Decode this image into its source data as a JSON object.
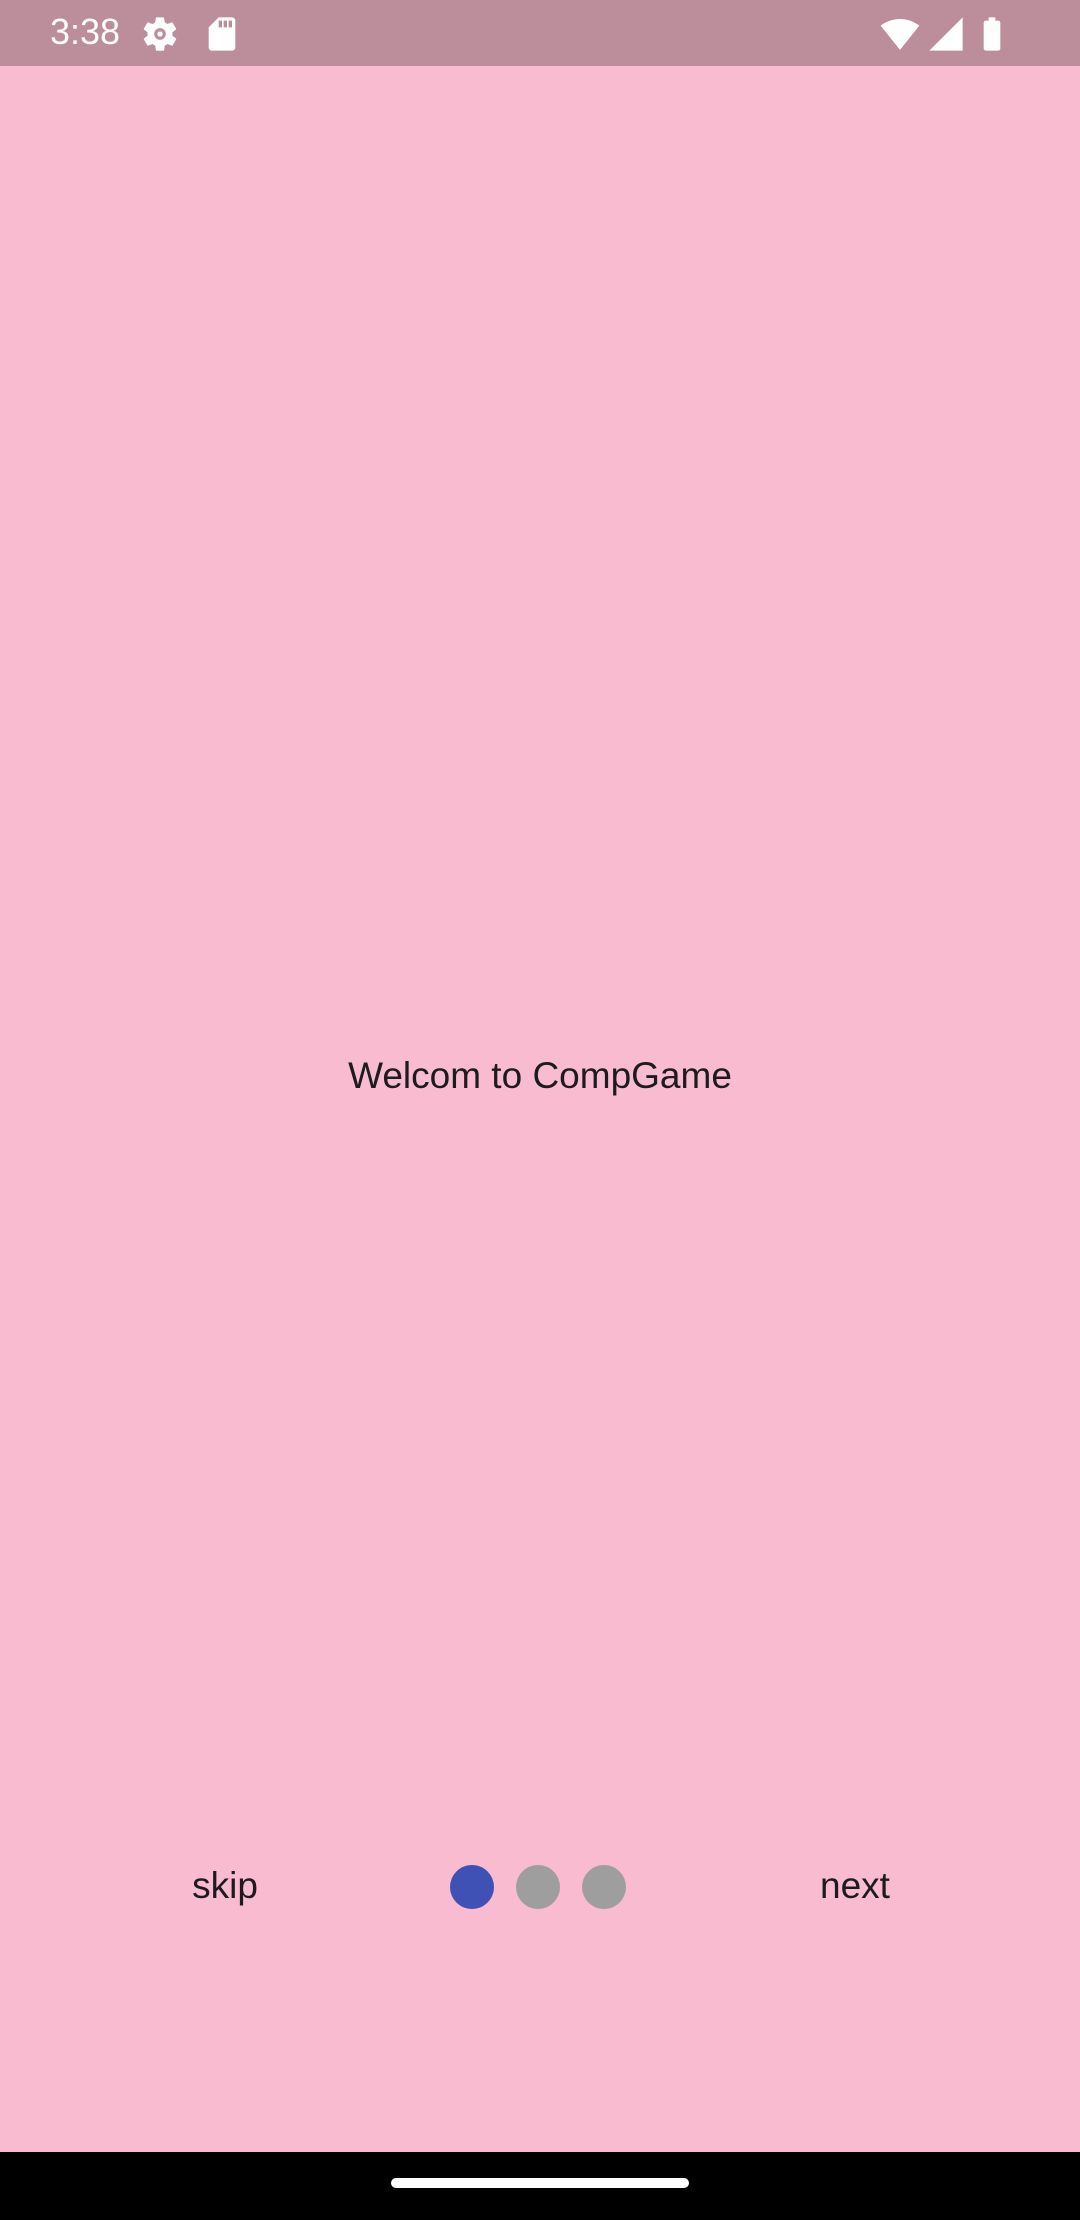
{
  "status_bar": {
    "time": "3:38",
    "icons": [
      "settings-icon",
      "sd-card-icon",
      "wifi-icon",
      "signal-icon",
      "battery-icon"
    ]
  },
  "main": {
    "welcome_text": "Welcom to CompGame"
  },
  "onboarding": {
    "skip_label": "skip",
    "next_label": "next",
    "page_indicator": {
      "total_pages": 3,
      "current_page": 1,
      "active_color": "#3F51B5",
      "inactive_color": "#9E9E9E"
    }
  },
  "colors": {
    "background": "#F8BBD0",
    "status_bar": "#BC8D9B",
    "nav_bar": "#000000"
  }
}
